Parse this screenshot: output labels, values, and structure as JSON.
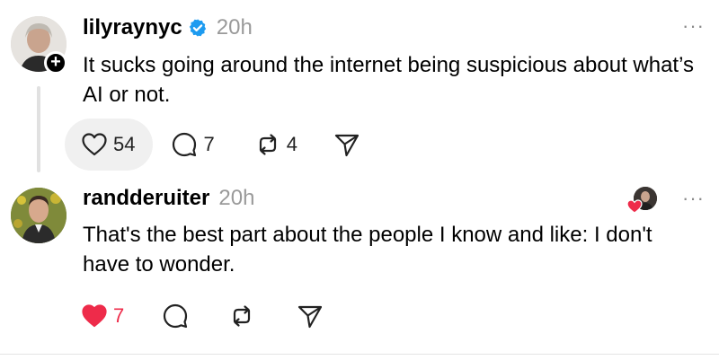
{
  "posts": [
    {
      "username": "lilyraynyc",
      "verified": true,
      "time": "20h",
      "text": "It sucks going around the internet being suspicious about what’s AI or not.",
      "more_label": "···",
      "follow_badge": "+",
      "likes": "54",
      "replies": "7",
      "reposts": "4",
      "liked": false,
      "icons": [
        "heart-icon",
        "comment-icon",
        "repost-icon",
        "share-icon",
        "verified-badge-icon",
        "more-icon",
        "plus-icon"
      ]
    },
    {
      "username": "randderuiter",
      "verified": false,
      "time": "20h",
      "text": "That's the best part about the people I know and like: I don't have to wonder.",
      "more_label": "···",
      "likes": "7",
      "liked": true,
      "icons": [
        "heart-filled-icon",
        "comment-icon",
        "repost-icon",
        "share-icon",
        "more-icon"
      ]
    }
  ],
  "colors": {
    "verified_blue": "#1d9bf0",
    "like_red": "#ee2b4a",
    "muted_gray": "#9a9a9a",
    "thread_line": "#e1e1e1"
  }
}
